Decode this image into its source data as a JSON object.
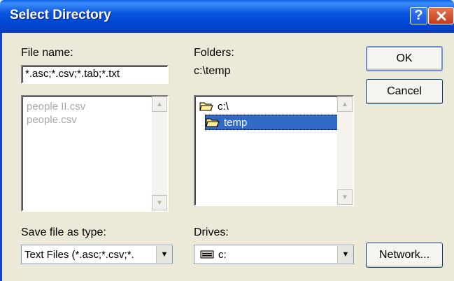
{
  "window": {
    "title": "Select Directory"
  },
  "file_name": {
    "label": "File name:",
    "value": "*.asc;*.csv;*.tab;*.txt"
  },
  "files": [
    "people II.csv",
    "people.csv"
  ],
  "folders": {
    "label": "Folders:",
    "path": "c:\\temp",
    "items": [
      "c:\\",
      "temp"
    ],
    "selected": "temp"
  },
  "save_type": {
    "label": "Save file as type:",
    "value": "Text Files (*.asc;*.csv;*."
  },
  "drives": {
    "label": "Drives:",
    "value": "c:"
  },
  "buttons": {
    "ok": "OK",
    "cancel": "Cancel",
    "network": "Network..."
  },
  "icons": {
    "help": "?",
    "close": "✕"
  },
  "colors": {
    "titlebar": "#0a55dc",
    "selection": "#316ac5",
    "dialog_bg": "#ece9d8"
  }
}
